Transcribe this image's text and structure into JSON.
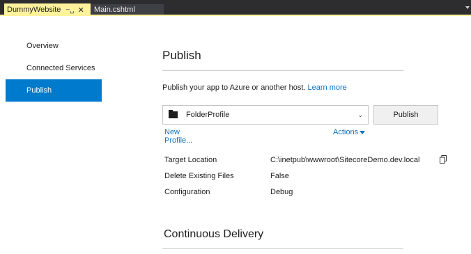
{
  "tabs": [
    {
      "label": "DummyWebsite",
      "pin": "−␣",
      "active": true
    },
    {
      "label": "Main.cshtml",
      "active": false
    }
  ],
  "nav": {
    "items": [
      {
        "label": "Overview",
        "selected": false
      },
      {
        "label": "Connected Services",
        "selected": false
      },
      {
        "label": "Publish",
        "selected": true
      }
    ]
  },
  "publish": {
    "title": "Publish",
    "description": "Publish your app to Azure or another host.",
    "learn_more": "Learn more",
    "profile_value": "FolderProfile",
    "publish_button": "Publish",
    "new_profile": "New Profile...",
    "actions": "Actions"
  },
  "properties": [
    {
      "label": "Target Location",
      "value": "C:\\inetpub\\wwwroot\\SitecoreDemo.dev.local"
    },
    {
      "label": "Delete Existing Files",
      "value": "False"
    },
    {
      "label": "Configuration",
      "value": "Debug"
    }
  ],
  "continuous_delivery": {
    "title": "Continuous Delivery"
  },
  "colors": {
    "accent": "#007acc",
    "tab_active": "#fff29d",
    "link": "#0e70c0",
    "tabstrip": "#2d2d30"
  }
}
